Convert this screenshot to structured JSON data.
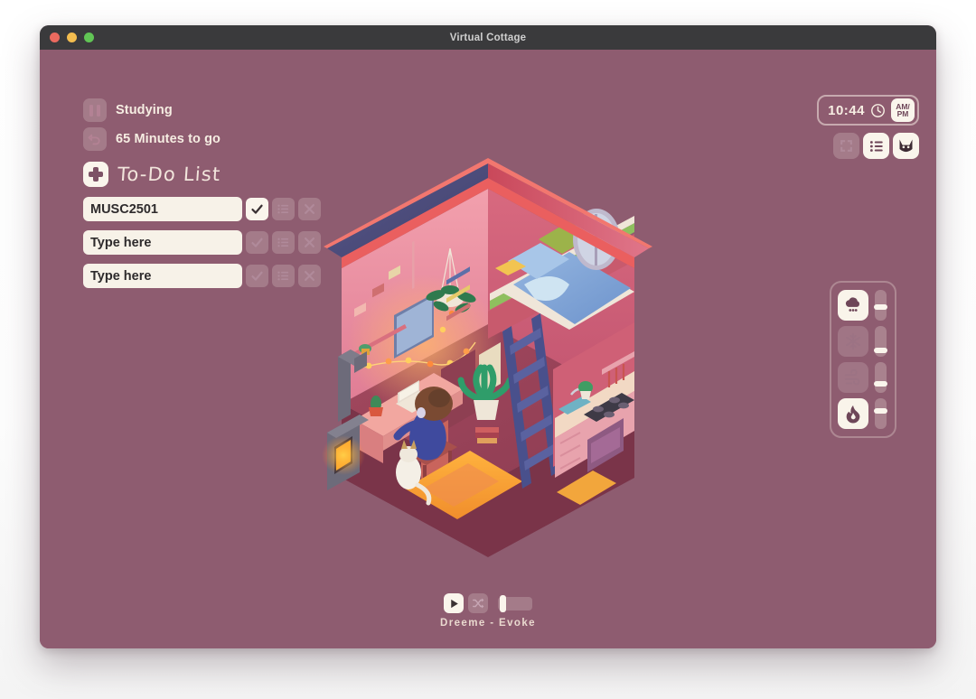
{
  "window": {
    "title": "Virtual Cottage",
    "traffic_lights": [
      "close",
      "minimize",
      "maximize"
    ],
    "background_color": "#8e5c70",
    "titlebar_color": "#3a3a3c"
  },
  "timer": {
    "pause_icon": "pause-icon",
    "status_label": "Studying",
    "reset_icon": "reset-icon",
    "remaining_label": "65 Minutes to go"
  },
  "todo": {
    "add_icon": "plus-icon",
    "title": "To-Do List",
    "items": [
      {
        "value": "MUSC2501",
        "placeholder": "Type here",
        "checked": true
      },
      {
        "value": "",
        "placeholder": "Type here",
        "checked": false
      },
      {
        "value": "",
        "placeholder": "Type here",
        "checked": false
      }
    ],
    "row_icons": [
      "check-icon",
      "list-icon",
      "close-icon"
    ]
  },
  "clock": {
    "time": "10:44",
    "clock_icon": "clock-icon",
    "ampm_top": "AM/",
    "ampm_bottom": "PM"
  },
  "toolbar": {
    "buttons": [
      {
        "icon": "fullscreen-icon",
        "active": false
      },
      {
        "icon": "list-icon",
        "active": true
      },
      {
        "icon": "cat-icon",
        "active": true
      }
    ]
  },
  "ambience": {
    "channels": [
      {
        "icon": "rain-icon",
        "active": true,
        "level": 55
      },
      {
        "icon": "snow-icon",
        "active": false,
        "level": 22
      },
      {
        "icon": "wind-icon",
        "active": false,
        "level": 30
      },
      {
        "icon": "fire-icon",
        "active": true,
        "level": 68
      }
    ]
  },
  "music": {
    "play_icon": "play-icon",
    "shuffle_icon": "shuffle-icon",
    "playing": true,
    "shuffle_on": false,
    "volume": 15,
    "track": "Dreeme - Evoke"
  },
  "scene": {
    "name": "isometric-cottage-illustration",
    "description": "Isometric cutaway cottage: loft bed with blue duvet and round window, person in blue sweater at desk with laptop, white cat, wood stove, ladder, kitchen with stove and sink, orange rug, string lights"
  },
  "colors": {
    "app_bg": "#8e5c70",
    "panel_cream": "#faf5ec",
    "text_cream": "#f6ede2",
    "roof": "#4c4b7a",
    "wall_pink": "#e8879a",
    "glow_orange": "#ff9a3c"
  }
}
